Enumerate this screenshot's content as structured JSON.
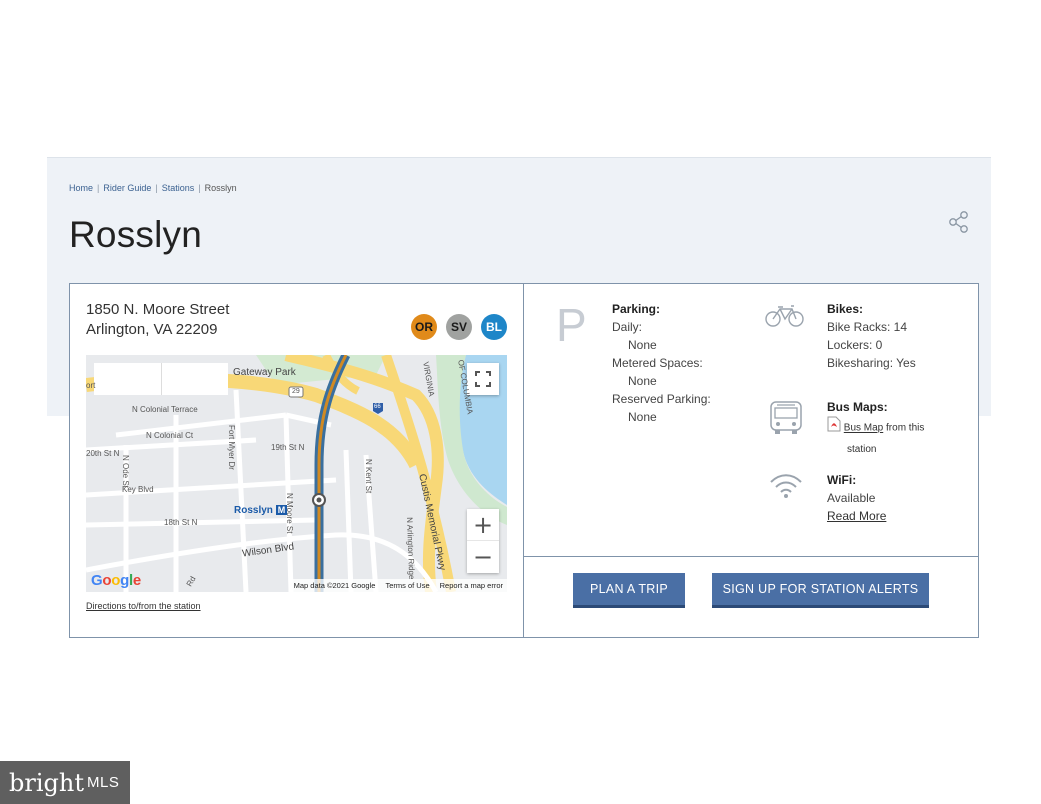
{
  "breadcrumb": {
    "home": "Home",
    "rider_guide": "Rider Guide",
    "stations": "Stations",
    "current": "Rosslyn"
  },
  "page": {
    "title": "Rosslyn"
  },
  "station": {
    "address_line1": "1850 N. Moore Street",
    "address_line2": "Arlington, VA 22209",
    "lines": [
      {
        "code": "OR",
        "color": "#e08a1a"
      },
      {
        "code": "SV",
        "color": "#a0a2a0"
      },
      {
        "code": "BL",
        "color": "#1e86c8"
      }
    ]
  },
  "map": {
    "labels": {
      "gateway_park": "Gateway Park",
      "colonial_terrace": "N Colonial Terrace",
      "colonial_ct": "N Colonial Ct",
      "fort_myer": "Fort Myer Dr",
      "n_19th": "19th St N",
      "n_20th": "20th St N",
      "ode": "N Ode St",
      "key": "Key Blvd",
      "n_18th": "18th St N",
      "rosslyn": "Rosslyn",
      "metro_mark": "M",
      "wilson": "Wilson Blvd",
      "moore": "N Moore St",
      "kent": "N Kent St",
      "custis": "Custis Memorial Pkwy",
      "arlington_ridge": "N Arlington Ridge",
      "virginia": "VIRGINIA",
      "dc": "OF COLUMBIA",
      "i66": "66",
      "rt29": "29",
      "ort": "ort",
      "rd": "Rd"
    },
    "google": [
      "G",
      "o",
      "o",
      "g",
      "l",
      "e"
    ],
    "footer": {
      "data": "Map data ©2021 Google",
      "terms": "Terms of Use",
      "report": "Report a map error"
    },
    "zoom_in": "+",
    "zoom_out": "−",
    "directions": "Directions to/from the station"
  },
  "parking": {
    "icon_letter": "P",
    "title": "Parking:",
    "daily_label": "Daily:",
    "daily_value": "None",
    "metered_label": "Metered Spaces:",
    "metered_value": "None",
    "reserved_label": "Reserved Parking:",
    "reserved_value": "None"
  },
  "bikes": {
    "title": "Bikes:",
    "racks": "Bike Racks: 14",
    "lockers": "Lockers: 0",
    "sharing": "Bikesharing: Yes"
  },
  "bus": {
    "title": "Bus Maps:",
    "link": "Bus Map",
    "suffix_1": "from this",
    "suffix_2": "station"
  },
  "wifi": {
    "title": "WiFi:",
    "status": "Available",
    "read_more": "Read More"
  },
  "buttons": {
    "plan_trip": "PLAN A TRIP",
    "alerts": "SIGN UP FOR STATION ALERTS"
  },
  "watermark": {
    "brand": "bright",
    "suffix": "MLS"
  }
}
